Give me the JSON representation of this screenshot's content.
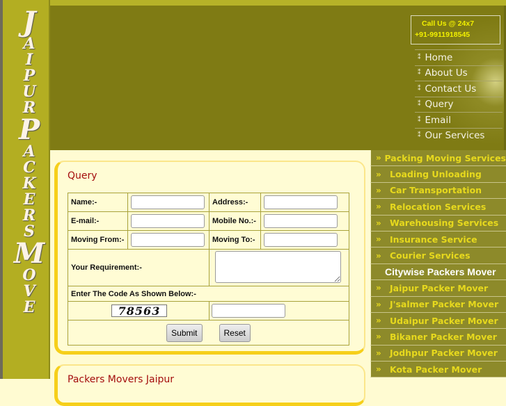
{
  "logo": {
    "letters": [
      "J",
      "A",
      "I",
      "P",
      "U",
      "R",
      "P",
      "A",
      "C",
      "K",
      "E",
      "R",
      "S",
      "M",
      "O",
      "V",
      "E"
    ]
  },
  "call": {
    "line1": "Call Us @ 24x7",
    "line2": "+91-9911918545"
  },
  "nav": [
    "Home",
    "About Us",
    "Contact Us",
    "Query",
    "Email",
    "Our Services"
  ],
  "services": [
    "Packing Moving Services",
    "Loading Unloading",
    "Car Transportation",
    "Relocation Services",
    "Warehousing Services",
    "Insurance Service",
    "Courier Services"
  ],
  "citywise_heading": "Citywise Packers Mover",
  "cities": [
    "Jaipur Packer Mover",
    "J'salmer Packer Mover",
    "Udaipur Packer Mover",
    "Bikaner Packer Mover",
    "Jodhpur Packer Mover",
    "Kota Packer Mover"
  ],
  "query": {
    "title": "Query",
    "name": "Name:-",
    "address": "Address:-",
    "email": "E-mail:-",
    "mobile": "Mobile No.:-",
    "from": "Moving From:-",
    "to": "Moving To:-",
    "requirement": "Your Requirement:-",
    "code_label": "Enter The Code As Shown Below:-",
    "captcha": "78563",
    "submit": "Submit",
    "reset": "Reset"
  },
  "box2": {
    "title": "Packers Movers Jaipur"
  }
}
